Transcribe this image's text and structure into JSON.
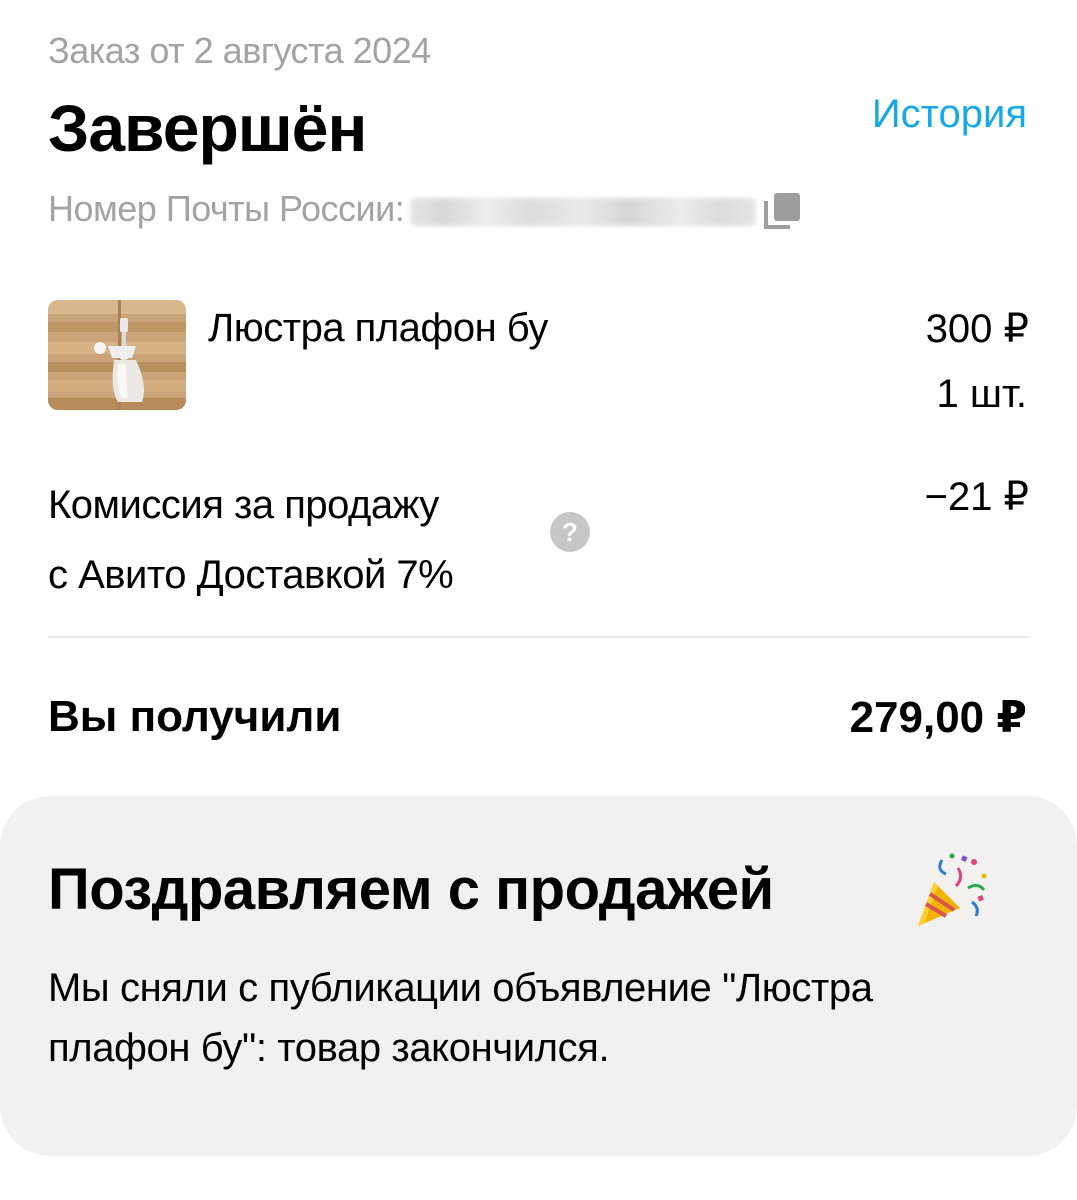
{
  "order": {
    "date_text": "Заказ от 2 августа 2024",
    "status": "Завершён",
    "history_link": "История",
    "tracking_label": "Номер Почты России:"
  },
  "item": {
    "name": "Люстра плафон бу",
    "price": "300 ₽",
    "quantity": "1 шт."
  },
  "commission": {
    "line1": "Комиссия за продажу",
    "line2": "с Авито Доставкой 7%",
    "value": "−21 ₽",
    "help_glyph": "?"
  },
  "total": {
    "label": "Вы получили",
    "value": "279,00 ₽"
  },
  "congrats": {
    "title": "Поздравляем с продажей",
    "line1": "Мы сняли с публикации объявление \"Люстра",
    "line2": "плафон бу\": товар закончился."
  },
  "colors": {
    "accent_link": "#16a9e8",
    "secondary_text": "#a3a3a3",
    "card_background": "#f2f1f0"
  },
  "icons": [
    "copy-icon",
    "help-icon",
    "party-popper-icon"
  ]
}
